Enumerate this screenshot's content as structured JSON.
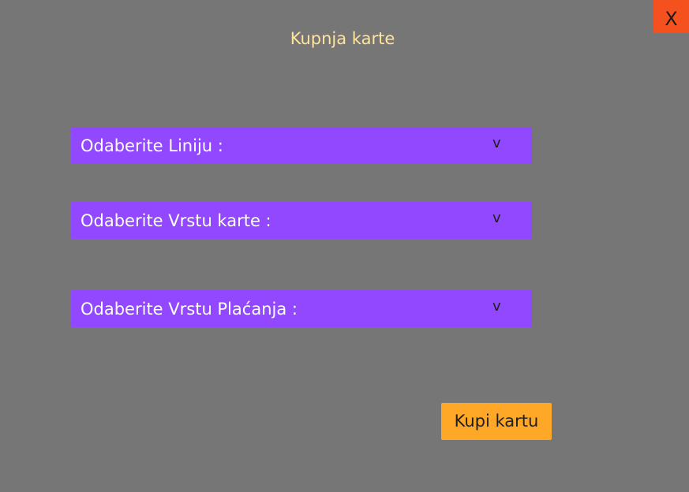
{
  "window": {
    "close_label": "X",
    "title": "Kupnja karte"
  },
  "form": {
    "selects": [
      {
        "label": "Odaberite Liniju :",
        "chevron": "v",
        "icon": "chevron-down-icon"
      },
      {
        "label": "Odaberite Vrstu karte :",
        "chevron": "v",
        "icon": "chevron-down-icon"
      },
      {
        "label": "Odaberite Vrstu Plaćanja :",
        "chevron": "v",
        "icon": "chevron-down-icon"
      }
    ],
    "submit_label": "Kupi kartu"
  },
  "colors": {
    "background": "#767676",
    "close": "#f4511e",
    "title": "#ffe49a",
    "select": "#9148ff",
    "submit": "#ffa726"
  }
}
